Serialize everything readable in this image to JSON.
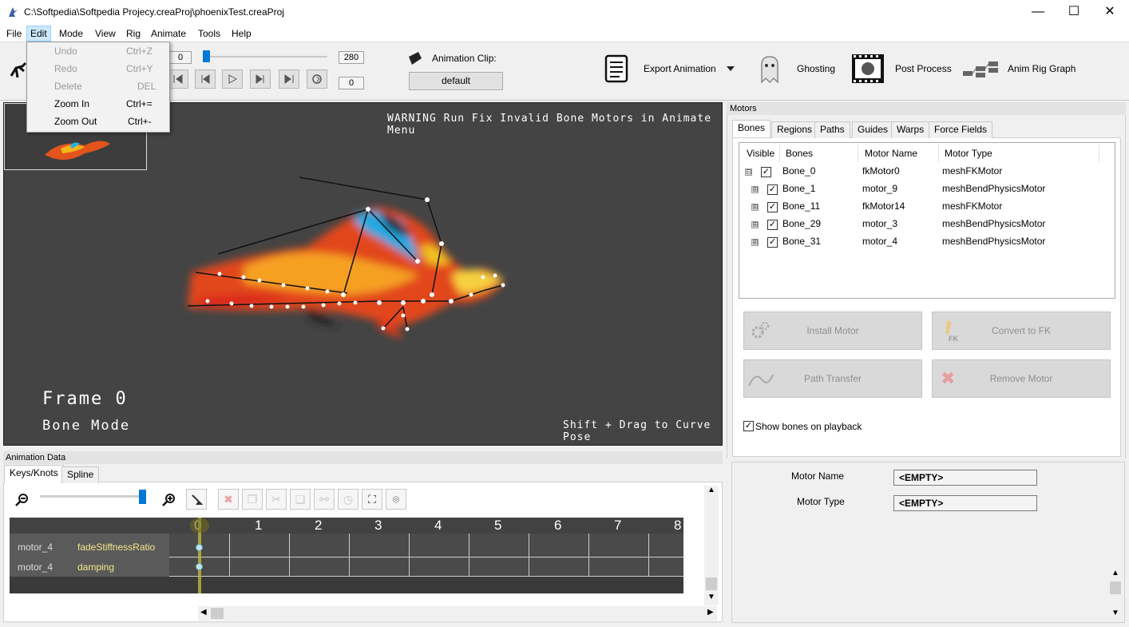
{
  "window": {
    "title": "C:\\Softpedia\\Softpedia Projecy.creaProj\\phoenixTest.creaProj",
    "minimize": "—",
    "maximize": "☐",
    "close": "✕"
  },
  "menubar": {
    "items": [
      "File",
      "Edit",
      "Mode",
      "View",
      "Rig",
      "Animate",
      "Tools",
      "Help"
    ],
    "active": "Edit"
  },
  "edit_menu": {
    "items": [
      {
        "label": "Undo",
        "shortcut": "Ctrl+Z",
        "enabled": false
      },
      {
        "label": "Redo",
        "shortcut": "Ctrl+Y",
        "enabled": false
      },
      {
        "label": "Delete",
        "shortcut": "DEL",
        "enabled": false
      },
      {
        "label": "Zoom In",
        "shortcut": "Ctrl+=",
        "enabled": true
      },
      {
        "label": "Zoom Out",
        "shortcut": "Ctrl+-",
        "enabled": true
      }
    ]
  },
  "toolbar": {
    "frame_start": "0",
    "frame_end": "280",
    "current_frame": "0",
    "slider_fraction": 0,
    "animation_clip_label": "Animation Clip:",
    "animation_clip_value": "default",
    "export_animation": "Export Animation",
    "ghosting": "Ghosting",
    "post_process": "Post Process",
    "anim_rig_graph": "Anim Rig Graph"
  },
  "viewport": {
    "warning": "WARNING Run Fix Invalid Bone Motors in Animate Menu",
    "frame_label": "Frame 0",
    "mode_label": "Bone Mode",
    "hint": "Shift + Drag to Curve Pose"
  },
  "animation_data": {
    "header": "Animation Data",
    "tabs": [
      "Keys/Knots",
      "Spline"
    ],
    "zoom_fraction": 0.97,
    "ticks": [
      "0",
      "1",
      "2",
      "3",
      "4",
      "5",
      "6",
      "7",
      "8"
    ],
    "rows": [
      {
        "motor": "motor_4",
        "property": "fadeStiffnessRatio"
      },
      {
        "motor": "motor_4",
        "property": "damping"
      }
    ]
  },
  "motors_panel": {
    "header": "Motors",
    "tabs": [
      "Bones",
      "Regions",
      "Paths",
      "Guides",
      "Warps",
      "Force Fields"
    ],
    "columns": [
      "Visible",
      "Bones",
      "Motor Name",
      "Motor Type"
    ],
    "bones": [
      {
        "name": "Bone_0",
        "motor": "fkMotor0",
        "type": "meshFKMotor",
        "expander": "⊟",
        "checked": "✓"
      },
      {
        "name": "Bone_1",
        "motor": "motor_9",
        "type": "meshBendPhysicsMotor",
        "expander": "⊞",
        "checked": "✓"
      },
      {
        "name": "Bone_11",
        "motor": "fkMotor14",
        "type": "meshFKMotor",
        "expander": "⊞",
        "checked": "✓"
      },
      {
        "name": "Bone_29",
        "motor": "motor_3",
        "type": "meshBendPhysicsMotor",
        "expander": "⊞",
        "checked": "✓"
      },
      {
        "name": "Bone_31",
        "motor": "motor_4",
        "type": "meshBendPhysicsMotor",
        "expander": "⊞",
        "checked": "✓"
      }
    ],
    "buttons": {
      "install_motor": "Install Motor",
      "convert_to_fk": "Convert to FK",
      "path_transfer": "Path Transfer",
      "remove_motor": "Remove Motor",
      "fk_badge": "FK"
    },
    "show_bones_label": "Show bones on playback",
    "show_bones_checked": "✓",
    "motor_name_label": "Motor Name",
    "motor_name_value": "<EMPTY>",
    "motor_type_label": "Motor Type",
    "motor_type_value": "<EMPTY>"
  },
  "colors": {
    "accent": "#0078d7",
    "viewport_bg": "#444444",
    "timeline_bg": "#424242",
    "playhead": "#c8c040"
  }
}
